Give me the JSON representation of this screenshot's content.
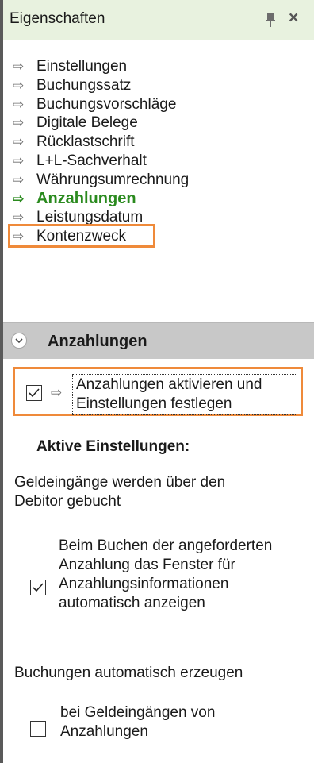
{
  "panel": {
    "title": "Eigenschaften"
  },
  "nav": {
    "items": [
      {
        "label": "Einstellungen"
      },
      {
        "label": "Buchungssatz"
      },
      {
        "label": "Buchungsvorschläge"
      },
      {
        "label": "Digitale Belege"
      },
      {
        "label": "Rücklastschrift"
      },
      {
        "label": "L+L-Sachverhalt"
      },
      {
        "label": "Währungsumrechnung"
      },
      {
        "label": "Anzahlungen"
      },
      {
        "label": "Leistungsdatum"
      },
      {
        "label": "Kontenzweck"
      }
    ],
    "active_index": 7
  },
  "section": {
    "title": "Anzahlungen",
    "activate": {
      "checked": true,
      "label": "Anzahlungen aktivieren und Einstellungen festlegen"
    },
    "active_heading": "Aktive Einstellungen:",
    "geld_text": "Geldeingänge werden über den Debitor gebucht",
    "beim_option": {
      "checked": true,
      "label": "Beim Buchen der angeforderten Anzahlung das Fenster für Anzahlungsinformationen automatisch anzeigen"
    },
    "buchungen_text": "Buchungen automatisch erzeugen",
    "bei_option": {
      "checked": false,
      "label": "bei Geldeingängen von Anzahlungen"
    }
  },
  "colors": {
    "accent_green": "#2a8a1e",
    "highlight_orange": "#ef8a3a",
    "header_green": "#e8f2df",
    "section_gray": "#c8c8c8"
  },
  "icons": {
    "nav_arrow": "⇨",
    "pin": "pin-icon",
    "close": "close-icon",
    "chevron": "chevron-down-icon"
  }
}
